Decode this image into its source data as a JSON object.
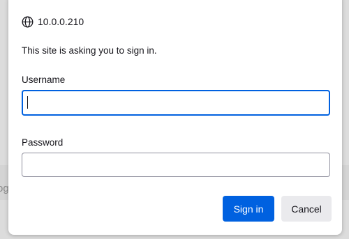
{
  "background": {
    "partial_text": "og"
  },
  "dialog": {
    "host": "10.0.0.210",
    "message": "This site is asking you to sign in.",
    "username": {
      "label": "Username",
      "value": "",
      "focused": true
    },
    "password": {
      "label": "Password",
      "value": ""
    },
    "buttons": {
      "sign_in": "Sign in",
      "cancel": "Cancel"
    }
  },
  "colors": {
    "accent": "#0061e0",
    "text": "#15141a",
    "secondary_button": "#eaeaed",
    "field_border": "#8f8f9d"
  },
  "icons": {
    "site": "globe-icon"
  }
}
